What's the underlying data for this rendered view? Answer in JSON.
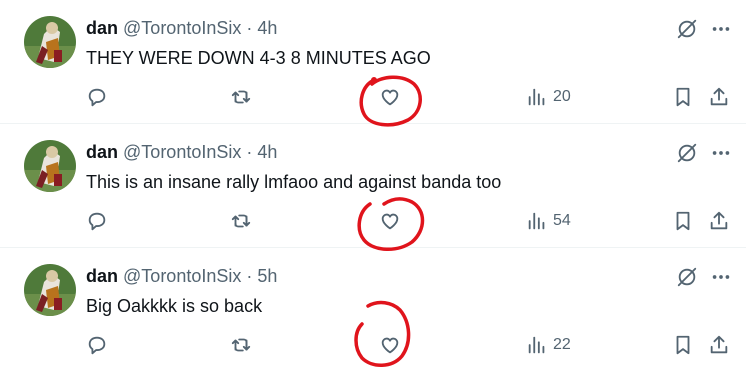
{
  "tweets": [
    {
      "name": "dan",
      "handle": "@TorontoInSix",
      "separator": "·",
      "time": "4h",
      "text": "THEY WERE DOWN 4-3 8 MINUTES AGO",
      "views": "20"
    },
    {
      "name": "dan",
      "handle": "@TorontoInSix",
      "separator": "·",
      "time": "4h",
      "text": "This is an insane rally lmfaoo and against banda too",
      "views": "54"
    },
    {
      "name": "dan",
      "handle": "@TorontoInSix",
      "separator": "·",
      "time": "5h",
      "text": "Big Oakkkk is so back",
      "views": "22"
    }
  ],
  "icons": {
    "reply": "reply-icon",
    "retweet": "retweet-icon",
    "like": "heart-icon",
    "views": "views-icon",
    "bookmark": "bookmark-icon",
    "share": "share-icon",
    "grok": "grok-icon",
    "more": "more-icon"
  },
  "colors": {
    "text": "#0f1419",
    "muted": "#536471",
    "annotation": "#e0141c",
    "divider": "#eff3f4"
  }
}
